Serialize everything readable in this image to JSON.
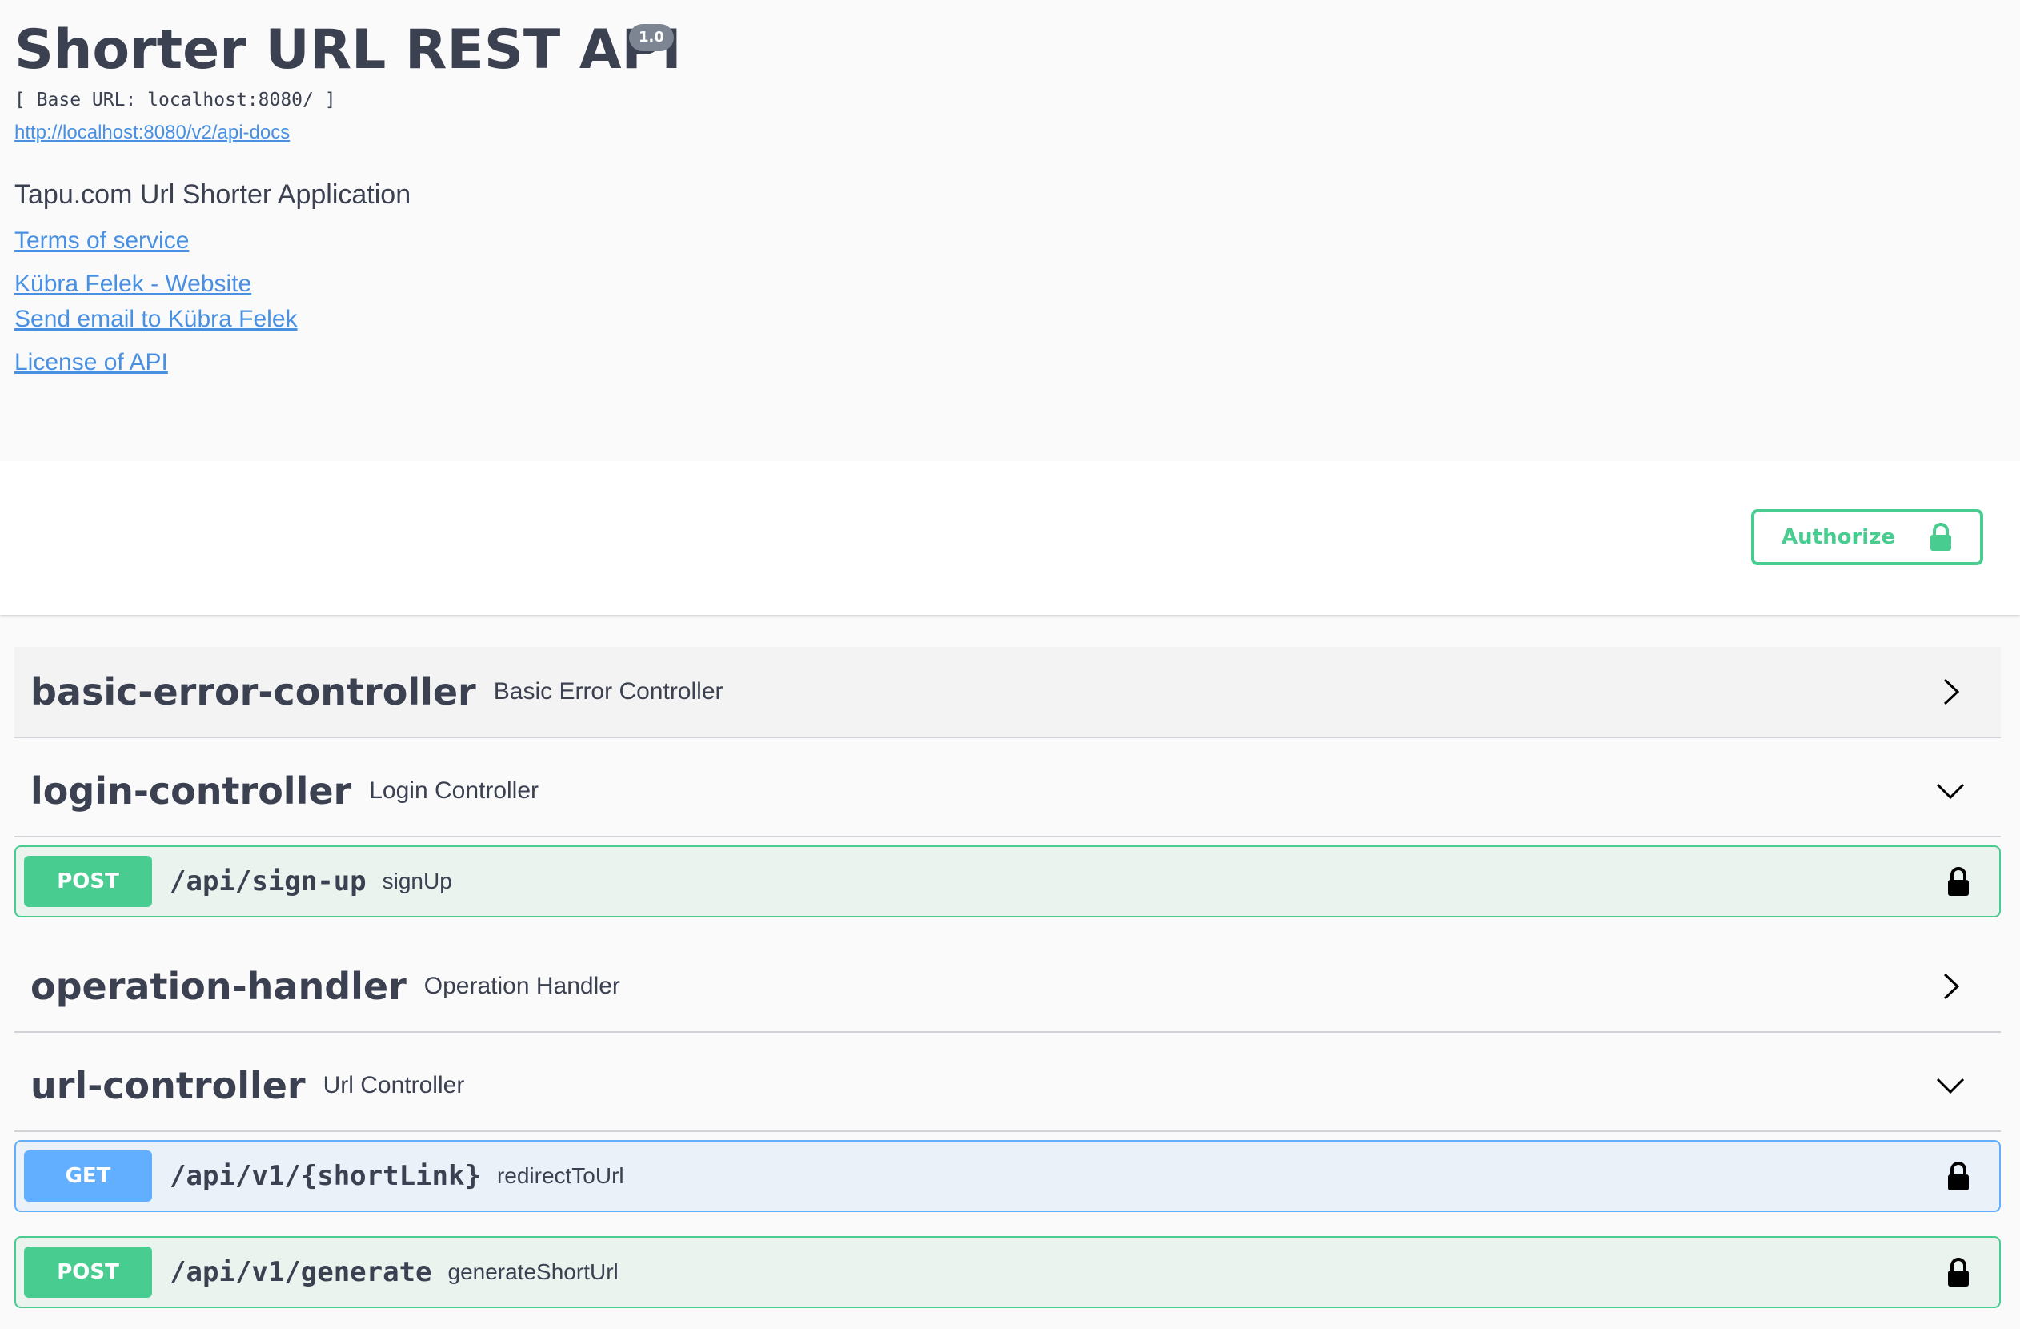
{
  "info": {
    "title": "Shorter URL REST API",
    "version": "1.0",
    "base_url": "[ Base URL: localhost:8080/ ]",
    "docs_link": "http://localhost:8080/v2/api-docs",
    "description": "Tapu.com Url Shorter Application",
    "terms_link": "Terms of service",
    "website_link": "Kübra Felek - Website",
    "email_link": "Send email to Kübra Felek",
    "license_link": "License of API"
  },
  "authorize": {
    "label": "Authorize",
    "icon": "lock-icon"
  },
  "tags": [
    {
      "name": "basic-error-controller",
      "description": "Basic Error Controller",
      "expanded": false
    },
    {
      "name": "login-controller",
      "description": "Login Controller",
      "expanded": true
    },
    {
      "name": "operation-handler",
      "description": "Operation Handler",
      "expanded": false
    },
    {
      "name": "url-controller",
      "description": "Url Controller",
      "expanded": true
    }
  ],
  "operations": [
    {
      "method": "POST",
      "path": "/api/sign-up",
      "summary": "signUp"
    },
    {
      "method": "GET",
      "path": "/api/v1/{shortLink}",
      "summary": "redirectToUrl"
    },
    {
      "method": "POST",
      "path": "/api/v1/generate",
      "summary": "generateShortUrl"
    }
  ],
  "colors": {
    "post": "#49cc90",
    "get": "#61affe",
    "link": "#4990e2",
    "text": "#3b4151"
  }
}
